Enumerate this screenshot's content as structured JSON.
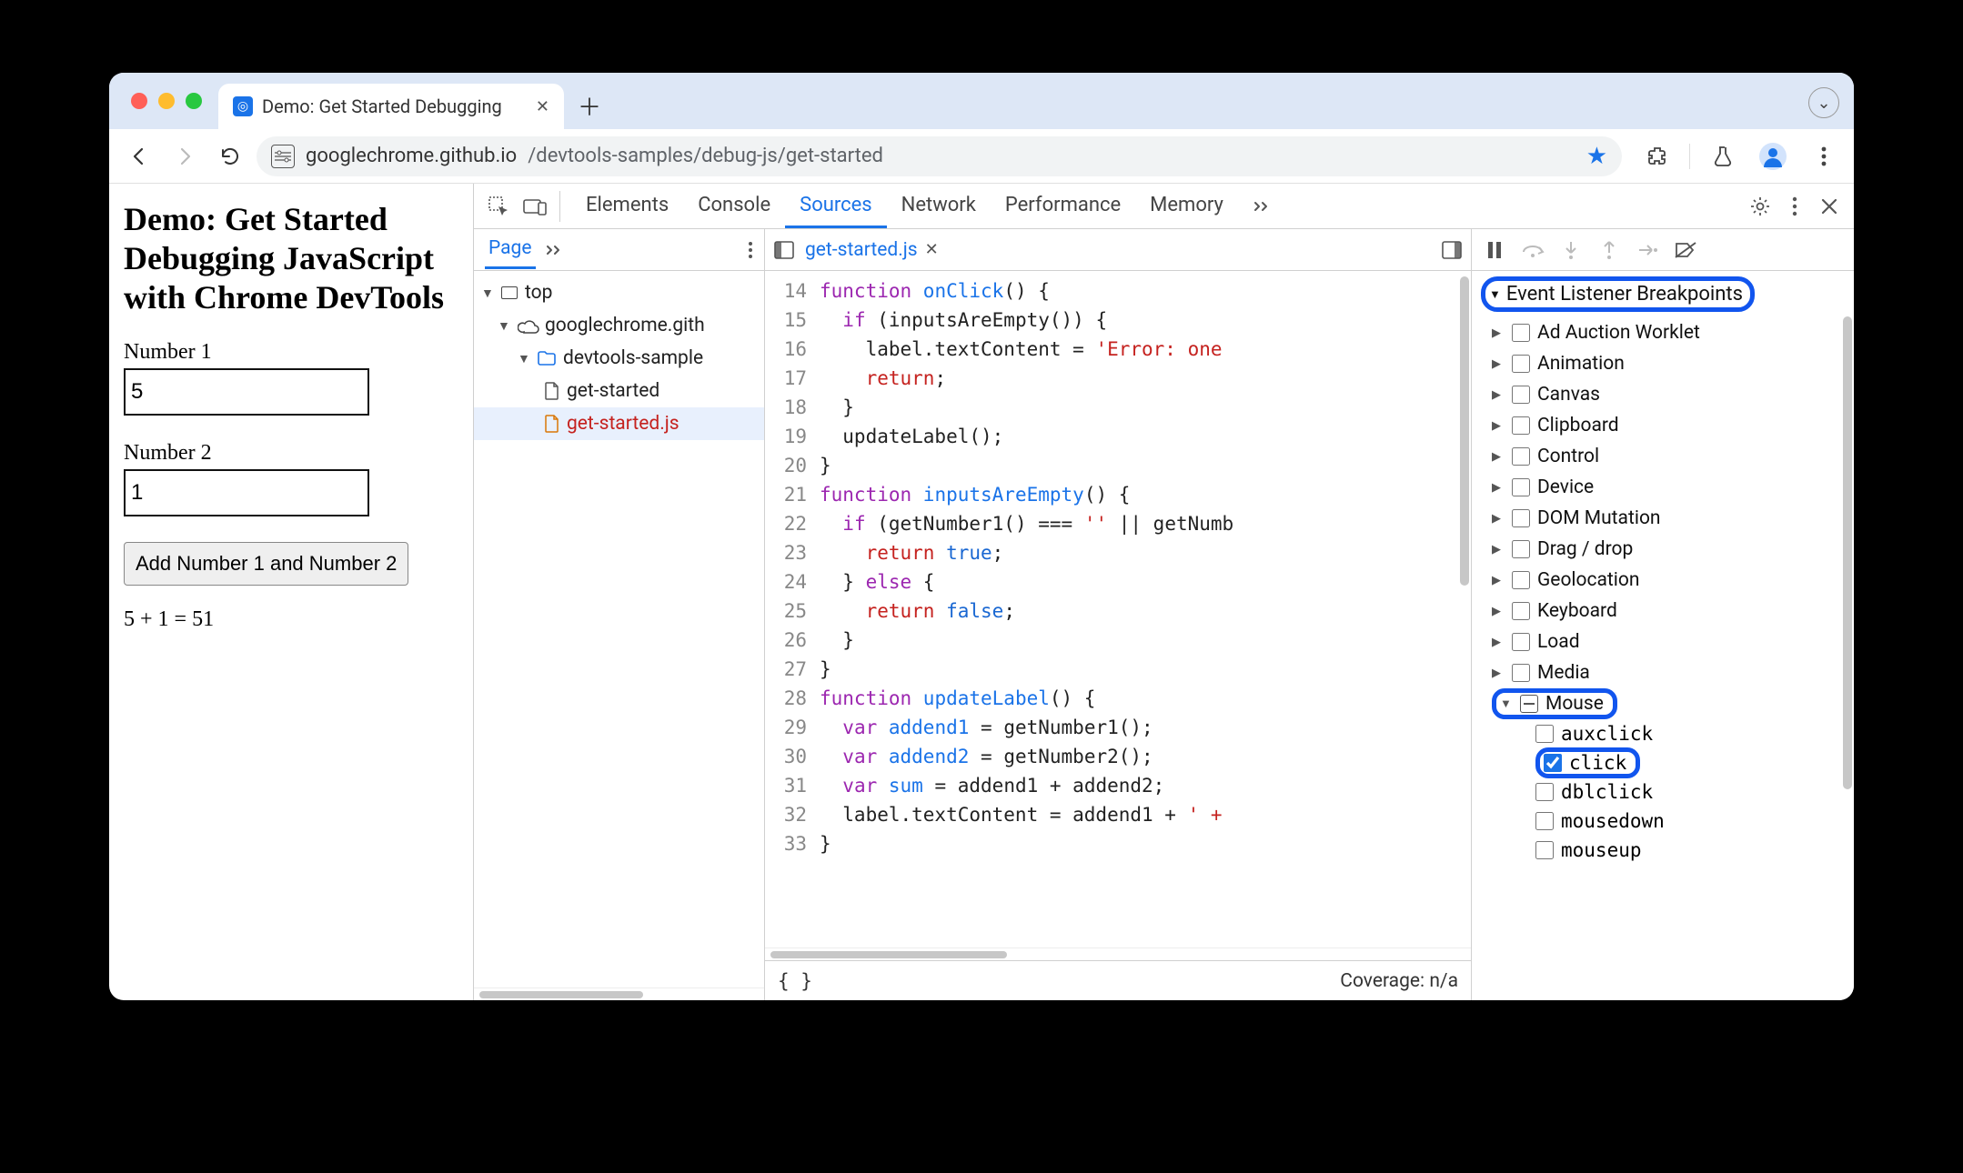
{
  "browser": {
    "tab_title": "Demo: Get Started Debugging",
    "url_host": "googlechrome.github.io",
    "url_path": "/devtools-samples/debug-js/get-started",
    "bookmarked": true
  },
  "page": {
    "heading": "Demo: Get Started Debugging JavaScript with Chrome DevTools",
    "label1": "Number 1",
    "value1": "5",
    "label2": "Number 2",
    "value2": "1",
    "button_label": "Add Number 1 and Number 2",
    "result_text": "5 + 1 = 51"
  },
  "devtools": {
    "panels": [
      "Elements",
      "Console",
      "Sources",
      "Network",
      "Performance",
      "Memory"
    ],
    "active_panel": "Sources",
    "navigator": {
      "page_tab": "Page",
      "tree": {
        "top": "top",
        "origin": "googlechrome.gith",
        "folder": "devtools-sample",
        "files": [
          "get-started",
          "get-started.js"
        ],
        "selected": "get-started.js"
      }
    },
    "editor": {
      "open_file": "get-started.js",
      "first_line_no": 14,
      "lines": [
        {
          "n": 14,
          "raw": "function onClick() {",
          "t": [
            [
              "kw",
              "function "
            ],
            [
              "fn",
              "onClick"
            ],
            [
              "",
              "() {"
            ]
          ]
        },
        {
          "n": 15,
          "raw": "  if (inputsAreEmpty()) {",
          "t": [
            [
              "",
              "  "
            ],
            [
              "kw",
              "if"
            ],
            [
              "",
              " (inputsAreEmpty()) {"
            ]
          ]
        },
        {
          "n": 16,
          "raw": "    label.textContent = 'Error: one",
          "t": [
            [
              "",
              "    label.textContent = "
            ],
            [
              "st",
              "'Error: one"
            ]
          ]
        },
        {
          "n": 17,
          "raw": "    return;",
          "t": [
            [
              "",
              "    "
            ],
            [
              "st",
              "return"
            ],
            [
              "",
              ";"
            ]
          ]
        },
        {
          "n": 18,
          "raw": "  }",
          "t": [
            [
              "",
              "  }"
            ]
          ]
        },
        {
          "n": 19,
          "raw": "  updateLabel();",
          "t": [
            [
              "",
              "  updateLabel();"
            ]
          ]
        },
        {
          "n": 20,
          "raw": "}",
          "t": [
            [
              "",
              "}"
            ]
          ]
        },
        {
          "n": 21,
          "raw": "function inputsAreEmpty() {",
          "t": [
            [
              "kw",
              "function "
            ],
            [
              "fn",
              "inputsAreEmpty"
            ],
            [
              "",
              "() {"
            ]
          ]
        },
        {
          "n": 22,
          "raw": "  if (getNumber1() === '' || getNumb",
          "t": [
            [
              "",
              "  "
            ],
            [
              "kw",
              "if"
            ],
            [
              "",
              " (getNumber1() === "
            ],
            [
              "st",
              "''"
            ],
            [
              "",
              " || getNumb"
            ]
          ]
        },
        {
          "n": 23,
          "raw": "    return true;",
          "t": [
            [
              "",
              "    "
            ],
            [
              "st",
              "return "
            ],
            [
              "lit",
              "true"
            ],
            [
              "",
              ";"
            ]
          ]
        },
        {
          "n": 24,
          "raw": "  } else {",
          "t": [
            [
              "",
              "  } "
            ],
            [
              "kw",
              "else"
            ],
            [
              "",
              " {"
            ]
          ]
        },
        {
          "n": 25,
          "raw": "    return false;",
          "t": [
            [
              "",
              "    "
            ],
            [
              "st",
              "return "
            ],
            [
              "lit",
              "false"
            ],
            [
              "",
              ";"
            ]
          ]
        },
        {
          "n": 26,
          "raw": "  }",
          "t": [
            [
              "",
              "  }"
            ]
          ]
        },
        {
          "n": 27,
          "raw": "}",
          "t": [
            [
              "",
              "}"
            ]
          ]
        },
        {
          "n": 28,
          "raw": "function updateLabel() {",
          "t": [
            [
              "kw",
              "function "
            ],
            [
              "fn",
              "updateLabel"
            ],
            [
              "",
              "() {"
            ]
          ]
        },
        {
          "n": 29,
          "raw": "  var addend1 = getNumber1();",
          "t": [
            [
              "",
              "  "
            ],
            [
              "kw",
              "var "
            ],
            [
              "fn",
              "addend1"
            ],
            [
              "",
              " = getNumber1();"
            ]
          ]
        },
        {
          "n": 30,
          "raw": "  var addend2 = getNumber2();",
          "t": [
            [
              "",
              "  "
            ],
            [
              "kw",
              "var "
            ],
            [
              "fn",
              "addend2"
            ],
            [
              "",
              " = getNumber2();"
            ]
          ]
        },
        {
          "n": 31,
          "raw": "  var sum = addend1 + addend2;",
          "t": [
            [
              "",
              "  "
            ],
            [
              "kw",
              "var "
            ],
            [
              "fn",
              "sum"
            ],
            [
              "",
              " = addend1 + addend2;"
            ]
          ]
        },
        {
          "n": 32,
          "raw": "  label.textContent = addend1 + ' +",
          "t": [
            [
              "",
              "  label.textContent = addend1 + "
            ],
            [
              "st",
              "' +"
            ]
          ]
        },
        {
          "n": 33,
          "raw": "}",
          "t": [
            [
              "",
              "}"
            ]
          ]
        }
      ],
      "coverage_label": "Coverage: n/a"
    },
    "debugger": {
      "section_title": "Event Listener Breakpoints",
      "categories": [
        {
          "label": "Ad Auction Worklet",
          "expanded": false,
          "state": "unchecked"
        },
        {
          "label": "Animation",
          "expanded": false,
          "state": "unchecked"
        },
        {
          "label": "Canvas",
          "expanded": false,
          "state": "unchecked"
        },
        {
          "label": "Clipboard",
          "expanded": false,
          "state": "unchecked"
        },
        {
          "label": "Control",
          "expanded": false,
          "state": "unchecked"
        },
        {
          "label": "Device",
          "expanded": false,
          "state": "unchecked"
        },
        {
          "label": "DOM Mutation",
          "expanded": false,
          "state": "unchecked"
        },
        {
          "label": "Drag / drop",
          "expanded": false,
          "state": "unchecked"
        },
        {
          "label": "Geolocation",
          "expanded": false,
          "state": "unchecked"
        },
        {
          "label": "Keyboard",
          "expanded": false,
          "state": "unchecked"
        },
        {
          "label": "Load",
          "expanded": false,
          "state": "unchecked"
        },
        {
          "label": "Media",
          "expanded": false,
          "state": "unchecked"
        },
        {
          "label": "Mouse",
          "expanded": true,
          "state": "indeterminate",
          "highlight": true,
          "children": [
            {
              "label": "auxclick",
              "checked": false
            },
            {
              "label": "click",
              "checked": true,
              "highlight": true
            },
            {
              "label": "dblclick",
              "checked": false
            },
            {
              "label": "mousedown",
              "checked": false
            },
            {
              "label": "mouseup",
              "checked": false
            }
          ]
        }
      ]
    }
  }
}
